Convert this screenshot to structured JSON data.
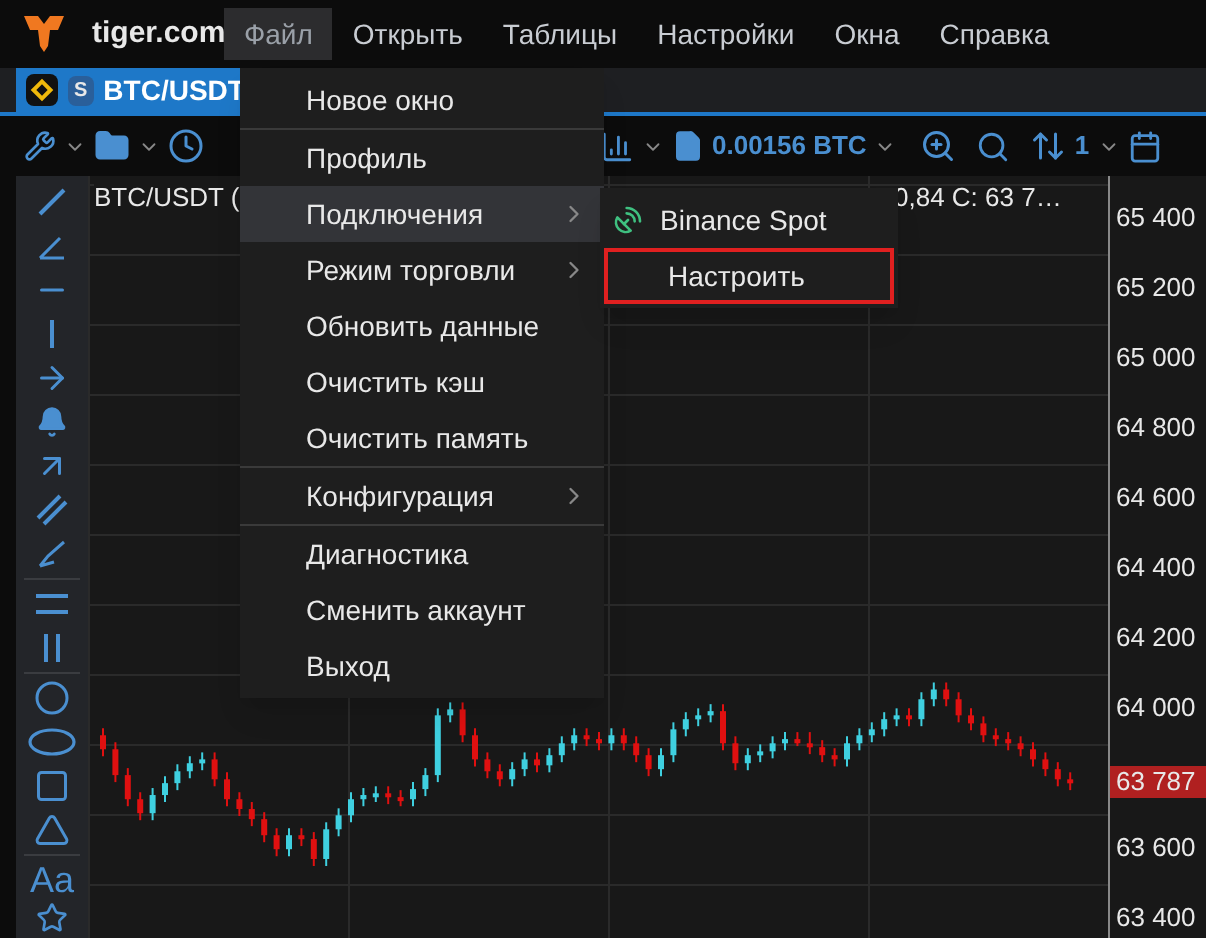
{
  "app": {
    "name": "tiger.com"
  },
  "menubar": [
    {
      "label": "Файл",
      "selected": true
    },
    {
      "label": "Открыть",
      "selected": false
    },
    {
      "label": "Таблицы",
      "selected": false
    },
    {
      "label": "Настройки",
      "selected": false
    },
    {
      "label": "Окна",
      "selected": false
    },
    {
      "label": "Справка",
      "selected": false
    }
  ],
  "symbol_tab": {
    "badge": "S",
    "label": "BTC/USDT",
    "selected": true
  },
  "toolbar": {
    "order_size": "0.00156 BTC",
    "scale_count": "1"
  },
  "drawing_tools": {
    "text_tool": "Aa"
  },
  "chart": {
    "header_left": "BTC/USDT (",
    "header_right": "0,84  C: 63 7…",
    "last_price": "63 787",
    "chart_data": {
      "type": "candlestick",
      "ylim": [
        63340,
        65520
      ],
      "yticks": [
        {
          "value": 65400,
          "label": "65 400"
        },
        {
          "value": 65200,
          "label": "65 200"
        },
        {
          "value": 65000,
          "label": "65 000"
        },
        {
          "value": 64800,
          "label": "64 800"
        },
        {
          "value": 64600,
          "label": "64 600"
        },
        {
          "value": 64400,
          "label": "64 400"
        },
        {
          "value": 64200,
          "label": "64 200"
        },
        {
          "value": 64000,
          "label": "64 000"
        },
        {
          "value": 63600,
          "label": "63 600"
        },
        {
          "value": 63400,
          "label": "63 400"
        }
      ],
      "ohlc": [
        [
          63920,
          63940,
          63860,
          63880
        ],
        [
          63880,
          63900,
          63786,
          63806
        ],
        [
          63806,
          63826,
          63717,
          63737
        ],
        [
          63737,
          63757,
          63677,
          63697
        ],
        [
          63697,
          63769,
          63677,
          63749
        ],
        [
          63749,
          63803,
          63729,
          63783
        ],
        [
          63783,
          63837,
          63763,
          63817
        ],
        [
          63817,
          63860,
          63797,
          63840
        ],
        [
          63840,
          63871,
          63820,
          63851
        ],
        [
          63851,
          63871,
          63774,
          63794
        ],
        [
          63794,
          63814,
          63717,
          63737
        ],
        [
          63737,
          63757,
          63689,
          63709
        ],
        [
          63709,
          63729,
          63660,
          63680
        ],
        [
          63680,
          63700,
          63614,
          63634
        ],
        [
          63634,
          63654,
          63574,
          63594
        ],
        [
          63594,
          63654,
          63574,
          63634
        ],
        [
          63634,
          63654,
          63603,
          63623
        ],
        [
          63623,
          63643,
          63546,
          63566
        ],
        [
          63566,
          63671,
          63546,
          63651
        ],
        [
          63651,
          63711,
          63631,
          63691
        ],
        [
          63691,
          63757,
          63671,
          63737
        ],
        [
          63737,
          63769,
          63717,
          63749
        ],
        [
          63749,
          63774,
          63729,
          63754
        ],
        [
          63754,
          63774,
          63723,
          63743
        ],
        [
          63743,
          63763,
          63717,
          63737
        ],
        [
          63737,
          63786,
          63717,
          63766
        ],
        [
          63766,
          63826,
          63746,
          63806
        ],
        [
          63806,
          63997,
          63786,
          63977
        ],
        [
          63977,
          64014,
          63957,
          63994
        ],
        [
          63994,
          64014,
          63900,
          63920
        ],
        [
          63920,
          63940,
          63831,
          63851
        ],
        [
          63851,
          63871,
          63797,
          63817
        ],
        [
          63817,
          63837,
          63774,
          63794
        ],
        [
          63794,
          63843,
          63774,
          63823
        ],
        [
          63823,
          63871,
          63803,
          63851
        ],
        [
          63851,
          63871,
          63814,
          63834
        ],
        [
          63834,
          63883,
          63814,
          63863
        ],
        [
          63863,
          63917,
          63843,
          63897
        ],
        [
          63897,
          63940,
          63877,
          63920
        ],
        [
          63920,
          63940,
          63889,
          63909
        ],
        [
          63909,
          63929,
          63877,
          63897
        ],
        [
          63897,
          63940,
          63877,
          63920
        ],
        [
          63920,
          63940,
          63877,
          63897
        ],
        [
          63897,
          63917,
          63843,
          63863
        ],
        [
          63863,
          63883,
          63803,
          63823
        ],
        [
          63823,
          63883,
          63803,
          63863
        ],
        [
          63863,
          63957,
          63843,
          63937
        ],
        [
          63937,
          63986,
          63917,
          63966
        ],
        [
          63966,
          63997,
          63946,
          63977
        ],
        [
          63977,
          64009,
          63957,
          63989
        ],
        [
          63989,
          64009,
          63877,
          63897
        ],
        [
          63897,
          63917,
          63820,
          63840
        ],
        [
          63840,
          63883,
          63820,
          63863
        ],
        [
          63863,
          63894,
          63843,
          63874
        ],
        [
          63874,
          63917,
          63854,
          63897
        ],
        [
          63897,
          63929,
          63877,
          63909
        ],
        [
          63909,
          63929,
          63889,
          63897
        ],
        [
          63897,
          63929,
          63866,
          63886
        ],
        [
          63886,
          63906,
          63843,
          63863
        ],
        [
          63863,
          63883,
          63831,
          63851
        ],
        [
          63851,
          63917,
          63831,
          63897
        ],
        [
          63897,
          63940,
          63877,
          63920
        ],
        [
          63920,
          63957,
          63900,
          63937
        ],
        [
          63937,
          63986,
          63917,
          63966
        ],
        [
          63966,
          63997,
          63946,
          63977
        ],
        [
          63977,
          63997,
          63946,
          63966
        ],
        [
          63966,
          64043,
          63946,
          64023
        ],
        [
          64023,
          64071,
          64003,
          64051
        ],
        [
          64051,
          64071,
          64003,
          64023
        ],
        [
          64023,
          64043,
          63957,
          63977
        ],
        [
          63977,
          63997,
          63934,
          63954
        ],
        [
          63954,
          63974,
          63900,
          63920
        ],
        [
          63920,
          63940,
          63889,
          63909
        ],
        [
          63909,
          63929,
          63877,
          63897
        ],
        [
          63897,
          63917,
          63860,
          63880
        ],
        [
          63880,
          63900,
          63831,
          63851
        ],
        [
          63851,
          63871,
          63803,
          63823
        ],
        [
          63823,
          63843,
          63774,
          63794
        ],
        [
          63794,
          63814,
          63763,
          63783
        ]
      ]
    }
  },
  "file_menu": [
    {
      "label": "Новое окно",
      "submenu": false,
      "selected": false,
      "separator_after": true
    },
    {
      "label": "Профиль",
      "submenu": false,
      "selected": false,
      "separator_after": false
    },
    {
      "label": "Подключения",
      "submenu": true,
      "selected": true,
      "separator_after": false
    },
    {
      "label": "Режим торговли",
      "submenu": true,
      "selected": false,
      "separator_after": false
    },
    {
      "label": "Обновить данные",
      "submenu": false,
      "selected": false,
      "separator_after": false
    },
    {
      "label": "Очистить кэш",
      "submenu": false,
      "selected": false,
      "separator_after": false
    },
    {
      "label": "Очистить память",
      "submenu": false,
      "selected": false,
      "separator_after": true
    },
    {
      "label": "Конфигурация",
      "submenu": true,
      "selected": false,
      "separator_after": true
    },
    {
      "label": "Диагностика",
      "submenu": false,
      "selected": false,
      "separator_after": false
    },
    {
      "label": "Сменить аккаунт",
      "submenu": false,
      "selected": false,
      "separator_after": false
    },
    {
      "label": "Выход",
      "submenu": false,
      "selected": false,
      "separator_after": false
    }
  ],
  "connections_submenu": [
    {
      "kind": "exchange",
      "label": "Binance Spot",
      "highlighted": false
    },
    {
      "kind": "action",
      "label": "Настроить",
      "highlighted": true
    }
  ]
}
